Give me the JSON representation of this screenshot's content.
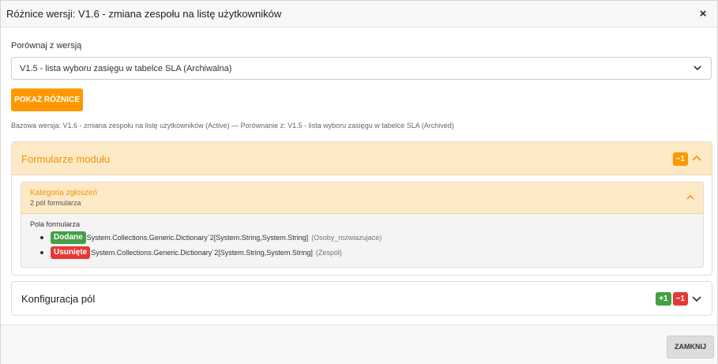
{
  "dialog": {
    "title": "Różnice wersji: V1.6 - zmiana zespołu na listę użytkowników",
    "close_icon": "×"
  },
  "compare": {
    "label": "Porównaj z wersją",
    "selected_value": "V1.5 - lista wyboru zasięgu w tabelce SLA (Archiwalna)"
  },
  "show_button": {
    "label": "POKAŻ RÓŻNICE"
  },
  "info_line": "Bazowa wersja: V1.6 - zmiana zespołu na listę użytkowników (Active) — Porównanie z: V1.5 - lista wyboru zasięgu w tabelce SLA (Archived)",
  "module_forms": {
    "title": "Formularze modułu",
    "badge": "~1",
    "subpanel": {
      "title": "Kategoria zgłoszeń",
      "count": "2 pól formularza",
      "fields_label": "Pola formularza",
      "rows": [
        {
          "tag": "Dodane",
          "name": "System.Collections.Generic.Dictionary`2[System.String,System.String]",
          "alias": "(Osoby_rozwiazujace)"
        },
        {
          "tag": "Usunięte",
          "name": "System.Collections.Generic.Dictionary`2[System.String,System.String]",
          "alias": "(Zespół)"
        }
      ]
    }
  },
  "field_config": {
    "title": "Konfiguracja pól",
    "badge_added": "+1",
    "badge_removed": "−1"
  },
  "footer": {
    "close_button": "ZAMKNIJ"
  },
  "colors": {
    "accent": "#ff9800",
    "added": "#43a047",
    "removed": "#e53935",
    "header_bg": "#fde9c6"
  },
  "icons": {
    "select": "chevron-down-icon",
    "module_toggle": "chevron-up-icon",
    "subpanel_toggle": "chevron-up-icon",
    "config_toggle": "chevron-down-icon",
    "close": "close-icon"
  }
}
